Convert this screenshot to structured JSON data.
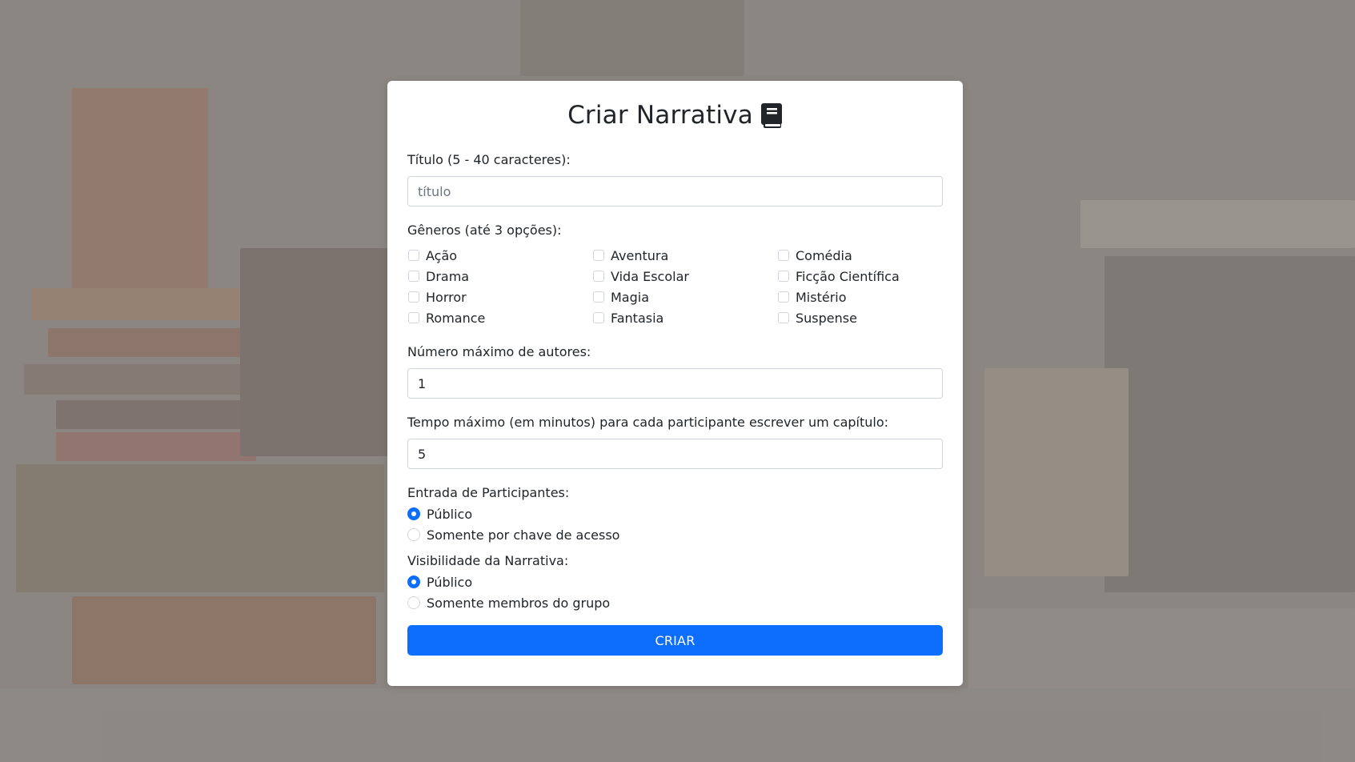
{
  "form": {
    "title": "Criar Narrativa",
    "title_icon": "book-icon",
    "titulo_label": "Título (5 - 40 caracteres):",
    "titulo_placeholder": "título",
    "generos_label": "Gêneros (até 3 opções):",
    "generos": [
      {
        "label": "Ação",
        "checked": false
      },
      {
        "label": "Aventura",
        "checked": false
      },
      {
        "label": "Comédia",
        "checked": false
      },
      {
        "label": "Drama",
        "checked": false
      },
      {
        "label": "Vida Escolar",
        "checked": false
      },
      {
        "label": "Ficção Científica",
        "checked": false
      },
      {
        "label": "Horror",
        "checked": false
      },
      {
        "label": "Magia",
        "checked": false
      },
      {
        "label": "Mistério",
        "checked": false
      },
      {
        "label": "Romance",
        "checked": false
      },
      {
        "label": "Fantasia",
        "checked": false
      },
      {
        "label": "Suspense",
        "checked": false
      }
    ],
    "autores_label": "Número máximo de autores:",
    "autores_value": "1",
    "tempo_label": "Tempo máximo (em minutos) para cada participante escrever um capítulo:",
    "tempo_value": "5",
    "entrada_label": "Entrada de Participantes:",
    "entrada_options": [
      {
        "label": "Público",
        "selected": true
      },
      {
        "label": "Somente por chave de acesso",
        "selected": false
      }
    ],
    "visibilidade_label": "Visibilidade da Narrativa:",
    "visibilidade_options": [
      {
        "label": "Público",
        "selected": true
      },
      {
        "label": "Somente membros do grupo",
        "selected": false
      }
    ],
    "submit_label": "CRIAR"
  },
  "colors": {
    "accent": "#0d6efd",
    "card_bg": "#ffffff",
    "background_tint": "#8a8480"
  }
}
